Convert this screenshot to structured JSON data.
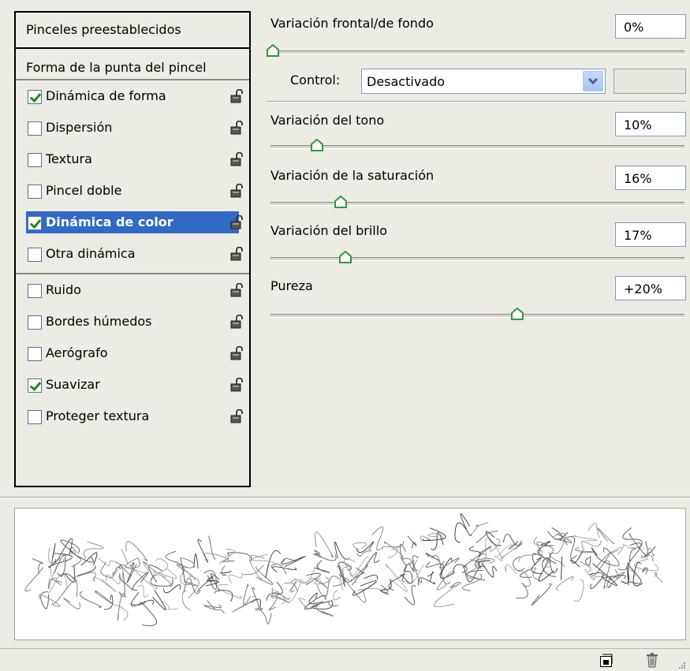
{
  "left": {
    "header_presets": "Pinceles preestablecidos",
    "header_tip": "Forma de la punta del pincel",
    "items": [
      {
        "label": "Dinámica de forma",
        "checked": true,
        "selected": false
      },
      {
        "label": "Dispersión",
        "checked": false,
        "selected": false
      },
      {
        "label": "Textura",
        "checked": false,
        "selected": false
      },
      {
        "label": "Pincel doble",
        "checked": false,
        "selected": false
      },
      {
        "label": "Dinámica de color",
        "checked": true,
        "selected": true
      },
      {
        "label": "Otra dinámica",
        "checked": false,
        "selected": false
      },
      {
        "label": "Ruido",
        "checked": false,
        "selected": false
      },
      {
        "label": "Bordes húmedos",
        "checked": false,
        "selected": false
      },
      {
        "label": "Aerógrafo",
        "checked": false,
        "selected": false
      },
      {
        "label": "Suavizar",
        "checked": true,
        "selected": false
      },
      {
        "label": "Proteger textura",
        "checked": false,
        "selected": false
      }
    ]
  },
  "right": {
    "fg_bg": {
      "label": "Variación frontal/de fondo",
      "value": "0%",
      "level": 0
    },
    "control": {
      "label": "Control:",
      "value": "Desactivado"
    },
    "hue": {
      "label": "Variación del tono",
      "value": "10%",
      "level": 10
    },
    "saturation": {
      "label": "Variación de la saturación",
      "value": "16%",
      "level": 16
    },
    "brightness": {
      "label": "Variación del brillo",
      "value": "17%",
      "level": 17
    },
    "purity": {
      "label": "Pureza",
      "value": "+20%",
      "level": 60
    }
  },
  "icons": {
    "lock": "lock-icon",
    "dropdown": "chevron-down-icon",
    "new_brush": "new-brush-icon",
    "trash": "trash-icon",
    "resize": "resize-grip-icon"
  },
  "colors": {
    "selection": "#316ac5",
    "check": "#1d8a1d",
    "thumb": "#2e9a3a"
  }
}
